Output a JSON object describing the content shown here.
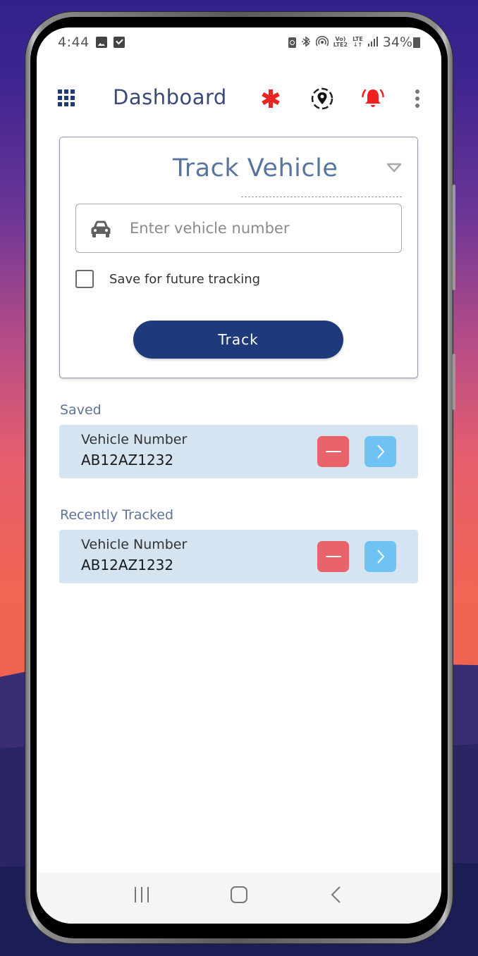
{
  "status_bar": {
    "time": "4:44",
    "left_icons": [
      "gallery-icon",
      "checkbox-notification-icon"
    ],
    "right_icons": [
      "battery-saver-icon",
      "bluetooth-icon",
      "hotspot-icon",
      "volte-icon",
      "lte-icon",
      "signal-icon"
    ],
    "volte_top": "Vo)",
    "volte_bottom": "LTE2",
    "lte_label": "LTE",
    "lte_arrows": "↓↑",
    "battery": "34%"
  },
  "header": {
    "title": "Dashboard",
    "icons": {
      "menu": "grid-icon",
      "emergency": "asterisk-icon",
      "location": "location-pin-icon",
      "alerts": "bell-icon",
      "more": "more-vertical-icon"
    },
    "colors": {
      "title": "#3a4a78",
      "emergency": "#e82424",
      "alerts": "#f02020",
      "grid": "#1e3a7a"
    }
  },
  "track_card": {
    "title": "Track Vehicle",
    "input": {
      "placeholder": "Enter vehicle number",
      "value": ""
    },
    "save_checkbox": {
      "label": "Save for future tracking",
      "checked": false
    },
    "track_button": "Track",
    "colors": {
      "title": "#5a74a0",
      "button": "#1f3a7a"
    }
  },
  "saved": {
    "label": "Saved",
    "items": [
      {
        "label": "Vehicle Number",
        "number": "AB12AZ1232"
      }
    ]
  },
  "recently_tracked": {
    "label": "Recently Tracked",
    "items": [
      {
        "label": "Vehicle Number",
        "number": "AB12AZ1232"
      }
    ]
  },
  "row_colors": {
    "background": "#d5e4f1",
    "remove": "#e8636a",
    "open": "#6fc3f4"
  },
  "nav_bar": {
    "buttons": [
      "recents-icon",
      "home-icon",
      "back-icon"
    ]
  }
}
